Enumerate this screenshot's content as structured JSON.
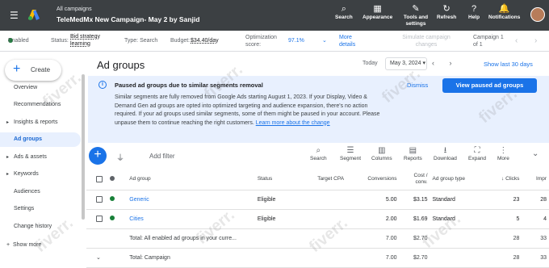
{
  "header": {
    "breadcrumb": "All campaigns",
    "campaign_title": "TeleMedMx New Campaign- May 2 by Sanjid",
    "buttons": [
      {
        "icon": "search-icon",
        "label": "Search"
      },
      {
        "icon": "appearance-icon",
        "label": "Appearance"
      },
      {
        "icon": "tools-icon",
        "label": "Tools and settings"
      },
      {
        "icon": "refresh-icon",
        "label": "Refresh"
      },
      {
        "icon": "help-icon",
        "label": "Help"
      },
      {
        "icon": "notifications-icon",
        "label": "Notifications"
      }
    ]
  },
  "status_bar": {
    "enabled": "Enabled",
    "status_label": "Status:",
    "status_value": "Bid strategy learning",
    "type": "Type: Search",
    "budget_label": "Budget:",
    "budget_value": "$34.40/day",
    "optimization_label": "Optimization score:",
    "optimization_value": "97.1%",
    "more_details": "More details",
    "simulate": "Simulate campaign changes",
    "campaign_count": "Campaign 1 of 1"
  },
  "sidebar": {
    "create_label": "Create",
    "items": [
      {
        "label": "Overview",
        "caret": false
      },
      {
        "label": "Recommendations",
        "caret": false
      },
      {
        "label": "Insights & reports",
        "caret": true
      },
      {
        "label": "Ad groups",
        "caret": false,
        "active": true
      },
      {
        "label": "Ads & assets",
        "caret": true
      },
      {
        "label": "Keywords",
        "caret": true
      },
      {
        "label": "Audiences",
        "caret": false
      },
      {
        "label": "Settings",
        "caret": false
      },
      {
        "label": "Change history",
        "caret": false
      }
    ],
    "show_more": "Show more"
  },
  "page": {
    "title": "Ad groups",
    "today_label": "Today",
    "date": "May 3, 2024",
    "range": "Show last 30 days"
  },
  "notice": {
    "title": "Paused ad groups due to similar segments removal",
    "body": "Similar segments are fully removed from Google Ads starting August 1, 2023. If your Display, Video & Demand Gen ad groups are opted into optimized targeting and audience expansion, there's no action required. If your ad groups used similar segments, some of them might be paused in your account. Please unpause them to continue reaching the right customers.",
    "link": "Learn more about the change",
    "dismiss": "Dismiss",
    "view_button": "View paused ad groups"
  },
  "toolbar": {
    "add_filter": "Add filter",
    "tools": [
      {
        "icon": "search-icon",
        "label": "Search"
      },
      {
        "icon": "segment-icon",
        "label": "Segment"
      },
      {
        "icon": "columns-icon",
        "label": "Columns"
      },
      {
        "icon": "reports-icon",
        "label": "Reports"
      },
      {
        "icon": "download-icon",
        "label": "Download"
      },
      {
        "icon": "expand-icon",
        "label": "Expand"
      },
      {
        "icon": "more-icon",
        "label": "More"
      }
    ]
  },
  "table": {
    "headers": {
      "ad_group": "Ad group",
      "status": "Status",
      "target_cpa": "Target CPA",
      "conversions": "Conversions",
      "cost_conv": "Cost / conv.",
      "ad_group_type": "Ad group type",
      "clicks": "Clicks",
      "impr": "Impr"
    },
    "rows": [
      {
        "name": "Generic",
        "status": "Eligible",
        "target_cpa": "",
        "conversions": "5.00",
        "cost_conv": "$3.15",
        "type": "Standard",
        "clicks": "23",
        "impr": "28"
      },
      {
        "name": "Cities",
        "status": "Eligible",
        "target_cpa": "",
        "conversions": "2.00",
        "cost_conv": "$1.69",
        "type": "Standard",
        "clicks": "5",
        "impr": "4"
      }
    ],
    "totals": [
      {
        "label": "Total: All enabled ad groups in your curre...",
        "conversions": "7.00",
        "cost_conv": "$2.70",
        "clicks": "28",
        "impr": "33"
      },
      {
        "label": "Total: Campaign",
        "conversions": "7.00",
        "cost_conv": "$2.70",
        "clicks": "28",
        "impr": "33"
      }
    ]
  },
  "watermark": "fiverr."
}
